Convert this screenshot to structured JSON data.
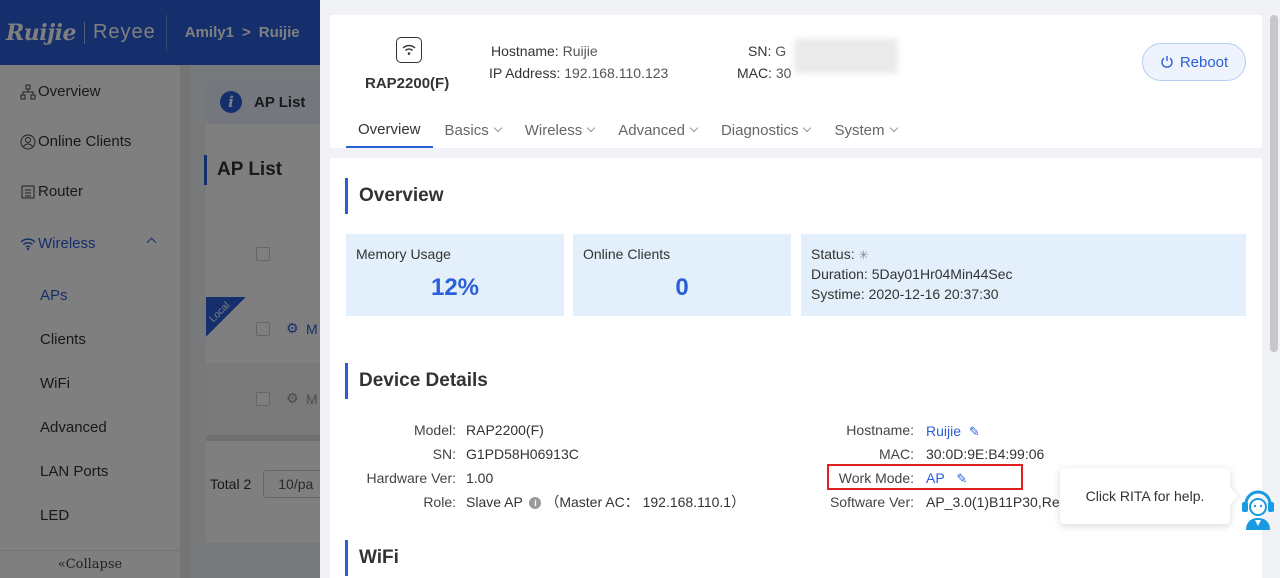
{
  "brand": {
    "logo": "Ruijie",
    "sub_logo": "Reyee"
  },
  "breadcrumb": {
    "network": "Amily1",
    "separator": ">",
    "device": "Ruijie"
  },
  "sidebar": {
    "items": [
      {
        "label": "Overview",
        "icon": "network-icon"
      },
      {
        "label": "Online Clients",
        "icon": "user-icon"
      },
      {
        "label": "Router",
        "icon": "router-icon"
      },
      {
        "label": "Wireless",
        "icon": "wifi-icon"
      }
    ],
    "sub_items": [
      "APs",
      "Clients",
      "WiFi",
      "Advanced",
      "LAN Ports",
      "LED"
    ],
    "collapse_label": "Collapse"
  },
  "background_page": {
    "tab_label": "AP List",
    "title": "AP List",
    "local_tag": "Local",
    "row1_text": "M",
    "row2_text": "M",
    "total_label": "Total 2",
    "pager_value": "10/pa"
  },
  "device": {
    "name": "RAP2200(F)",
    "hostname_label": "Hostname:",
    "hostname": "Ruijie",
    "ip_label": "IP Address:",
    "ip": "192.168.110.123",
    "sn_label": "SN:",
    "sn_partial": "G",
    "mac_label": "MAC:",
    "mac_partial": "30",
    "reboot_label": "Reboot"
  },
  "tabs": [
    {
      "label": "Overview",
      "active": true
    },
    {
      "label": "Basics"
    },
    {
      "label": "Wireless"
    },
    {
      "label": "Advanced"
    },
    {
      "label": "Diagnostics"
    },
    {
      "label": "System"
    }
  ],
  "overview": {
    "title": "Overview",
    "memory_label": "Memory Usage",
    "memory_value": "12%",
    "clients_label": "Online Clients",
    "clients_value": "0",
    "status_label": "Status:",
    "duration_label": "Duration:",
    "duration_value": "5Day01Hr04Min44Sec",
    "systime_label": "Systime:",
    "systime_value": "2020-12-16 20:37:30"
  },
  "device_details": {
    "title": "Device Details",
    "model_label": "Model:",
    "model": "RAP2200(F)",
    "sn_label": "SN:",
    "sn": "G1PD58H06913C",
    "hw_label": "Hardware Ver:",
    "hw": "1.00",
    "role_label": "Role:",
    "role": "Slave AP",
    "master": "（Master AC： 192.168.110.1）",
    "hostname_label": "Hostname:",
    "hostname": "Ruijie",
    "mac_label": "MAC:",
    "mac": "30:0D:9E:B4:99:06",
    "workmode_label": "Work Mode:",
    "workmode": "AP",
    "sw_label": "Software Ver:",
    "sw": "AP_3.0(1)B11P30,Re"
  },
  "wifi_section": {
    "title": "WiFi"
  },
  "help": {
    "text": "Click RITA for help."
  },
  "colors": {
    "accent": "#2a5fd8",
    "highlight": "#e02020",
    "stat_bg": "#e3f0fb"
  }
}
